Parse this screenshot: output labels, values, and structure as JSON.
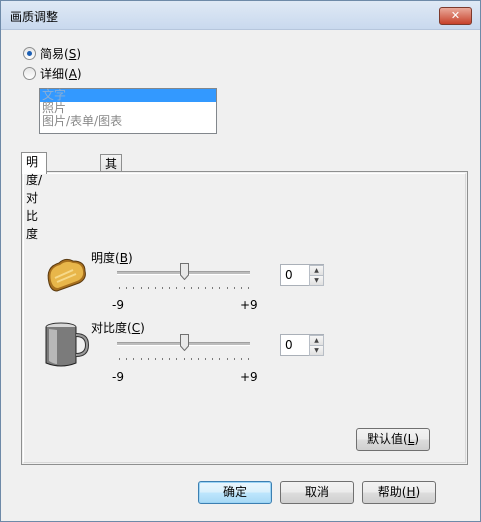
{
  "window": {
    "title": "画质调整",
    "close_glyph": "✕"
  },
  "mode": {
    "options": [
      {
        "label": "简易",
        "accel": "S",
        "checked": true
      },
      {
        "label": "详细",
        "accel": "A",
        "checked": false
      }
    ]
  },
  "doc_type_list": {
    "items": [
      {
        "label": "文字",
        "selected": true
      },
      {
        "label": "照片",
        "selected": false
      },
      {
        "label": "图片/表单/图表",
        "selected": false
      }
    ]
  },
  "tabs": [
    {
      "label": "明度/对比度",
      "active": true
    },
    {
      "label": "其它",
      "active": false
    }
  ],
  "brightness": {
    "label": "明度",
    "accel": "B",
    "min_label": "-9",
    "max_label": "+9",
    "min": -9,
    "max": 9,
    "value": 0,
    "icon": "toast-icon"
  },
  "contrast": {
    "label": "对比度",
    "accel": "C",
    "min_label": "-9",
    "max_label": "+9",
    "min": -9,
    "max": 9,
    "value": 0,
    "icon": "mug-icon"
  },
  "default_button": {
    "label": "默认值",
    "accel": "L"
  },
  "footer": {
    "ok_label": "确定",
    "cancel_label": "取消",
    "help_label": "帮助",
    "help_accel": "H"
  }
}
